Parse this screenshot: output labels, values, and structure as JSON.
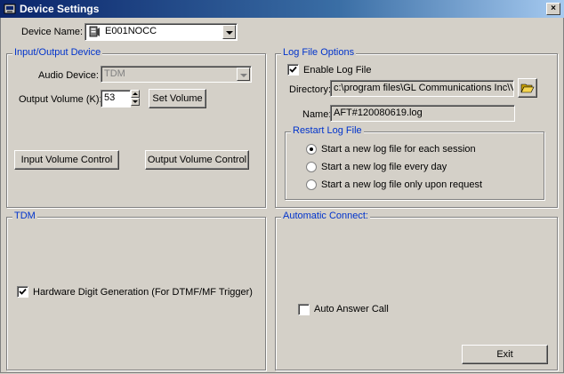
{
  "window": {
    "title": "Device Settings",
    "close_label": "×"
  },
  "device": {
    "label": "Device Name:",
    "value": "E001NOCC"
  },
  "io": {
    "legend": "Input/Output Device",
    "audio_label": "Audio Device:",
    "audio_value": "TDM",
    "volume_label": "Output Volume (K):",
    "volume_value": "53",
    "set_volume": "Set Volume",
    "input_volume_control": "Input Volume Control",
    "output_volume_control": "Output Volume Control"
  },
  "log": {
    "legend": "Log File Options",
    "enable_label": "Enable Log File",
    "enable_checked": true,
    "directory_label": "Directory:",
    "directory_value": "c:\\program files\\GL Communications Inc\\V",
    "name_label": "Name:",
    "name_value": "AFT#120080619.log",
    "restart": {
      "legend": "Restart Log File",
      "options": [
        {
          "label": "Start a new log file for each session",
          "selected": true
        },
        {
          "label": "Start a new log file every day",
          "selected": false
        },
        {
          "label": "Start a new log file only upon request",
          "selected": false
        }
      ]
    }
  },
  "tdm": {
    "legend": "TDM",
    "hw_digit_label": "Hardware Digit Generation (For DTMF/MF Trigger)",
    "hw_digit_checked": true
  },
  "auto": {
    "legend": "Automatic Connect:",
    "auto_answer_label": "Auto Answer Call",
    "auto_answer_checked": false
  },
  "exit_label": "Exit",
  "colors": {
    "legend": "#0033cc",
    "titlebar": "#0a246a",
    "face": "#d4d0c8"
  }
}
